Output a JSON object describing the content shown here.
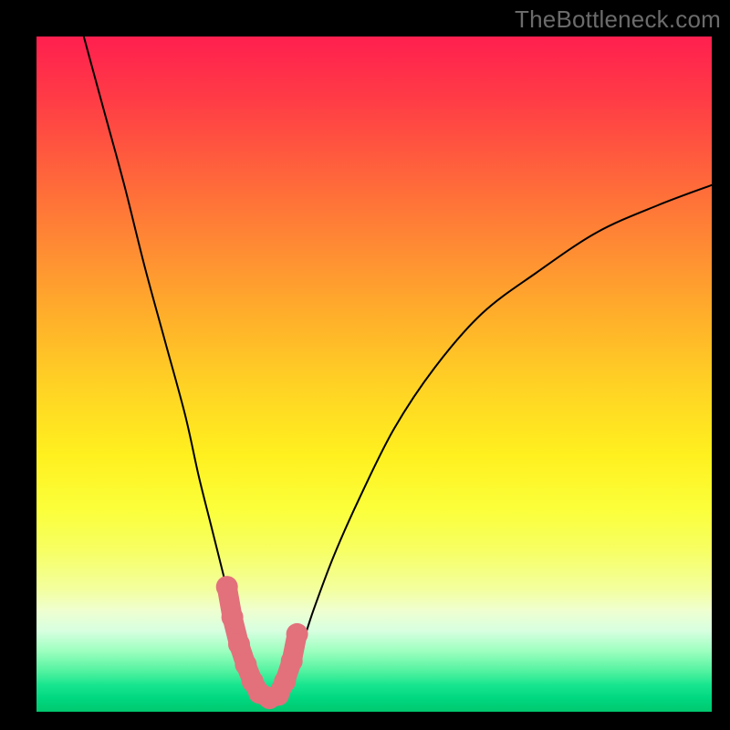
{
  "watermark": "TheBottleneck.com",
  "chart_data": {
    "type": "line",
    "title": "",
    "xlabel": "",
    "ylabel": "",
    "xlim": [
      0,
      100
    ],
    "ylim": [
      0,
      100
    ],
    "grid": false,
    "legend": null,
    "series": [
      {
        "name": "bottleneck-curve",
        "x": [
          7,
          10,
          13,
          16,
          19,
          22,
          24,
          26,
          28,
          29.5,
          31,
          32,
          33,
          34,
          35,
          36,
          37,
          39,
          41,
          44,
          48,
          53,
          59,
          66,
          74,
          83,
          92,
          100
        ],
        "y": [
          100,
          89,
          78,
          66,
          55,
          44,
          35,
          27,
          19,
          13,
          8,
          5,
          3,
          2,
          2,
          3,
          5,
          9,
          15,
          23,
          32,
          42,
          51,
          59,
          65,
          71,
          75,
          78
        ]
      }
    ],
    "markers": {
      "name": "highlight-points",
      "color": "#e2717c",
      "x": [
        28.2,
        29.0,
        30.0,
        31.0,
        32.0,
        33.0,
        34.5,
        35.8,
        36.8,
        37.8,
        38.6
      ],
      "y": [
        18.5,
        14.0,
        10.0,
        7.0,
        4.5,
        2.8,
        2.0,
        2.5,
        4.5,
        7.5,
        11.5
      ]
    },
    "annotations": []
  }
}
